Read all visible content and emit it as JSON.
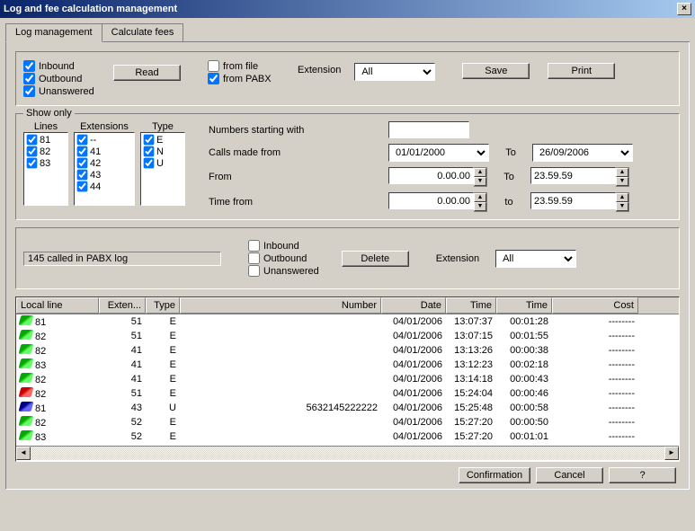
{
  "window": {
    "title": "Log and fee calculation management"
  },
  "tabs": [
    {
      "label": "Log management",
      "active": true
    },
    {
      "label": "Calculate fees",
      "active": false
    }
  ],
  "filters": {
    "inbound": "Inbound",
    "outbound": "Outbound",
    "unanswered": "Unanswered",
    "read_btn": "Read",
    "from_file": "from file",
    "from_pabx": "from PABX",
    "extension_label": "Extension",
    "extension_value": "All",
    "save_btn": "Save",
    "print_btn": "Print"
  },
  "showonly": {
    "legend": "Show only",
    "lines_label": "Lines",
    "extensions_label": "Extensions",
    "type_label": "Type",
    "lines": [
      "81",
      "82",
      "83"
    ],
    "extensions": [
      "--",
      "41",
      "42",
      "43",
      "44"
    ],
    "types": [
      "E",
      "N",
      "U"
    ],
    "numbers_starting_label": "Numbers starting with",
    "numbers_starting_value": "",
    "calls_from_label": "Calls made from",
    "calls_from_value": "01/01/2000",
    "calls_to_label": "To",
    "calls_to_value": "26/09/2006",
    "from_label": "From",
    "from_value": "0.00.00",
    "from_to_label": "To",
    "from_to_value": "23.59.59",
    "time_from_label": "Time from",
    "time_from_value": "0.00.00",
    "time_to_label": "to",
    "time_to_value": "23.59.59"
  },
  "mid": {
    "status": "145 called in PABX log",
    "inbound": "Inbound",
    "outbound": "Outbound",
    "unanswered": "Unanswered",
    "delete_btn": "Delete",
    "extension_label": "Extension",
    "extension_value": "All"
  },
  "grid_headers": [
    "Local line",
    "Exten...",
    "Type",
    "Number",
    "Date",
    "Time",
    "Time",
    "Cost"
  ],
  "grid_rows": [
    {
      "icon": "green",
      "line": "81",
      "ext": "51",
      "type": "E",
      "number": "",
      "date": "04/01/2006",
      "t1": "13:07:37",
      "t2": "00:01:28",
      "cost": "--------"
    },
    {
      "icon": "green",
      "line": "82",
      "ext": "51",
      "type": "E",
      "number": "",
      "date": "04/01/2006",
      "t1": "13:07:15",
      "t2": "00:01:55",
      "cost": "--------"
    },
    {
      "icon": "green",
      "line": "82",
      "ext": "41",
      "type": "E",
      "number": "",
      "date": "04/01/2006",
      "t1": "13:13:26",
      "t2": "00:00:38",
      "cost": "--------"
    },
    {
      "icon": "green",
      "line": "83",
      "ext": "41",
      "type": "E",
      "number": "",
      "date": "04/01/2006",
      "t1": "13:12:23",
      "t2": "00:02:18",
      "cost": "--------"
    },
    {
      "icon": "green",
      "line": "82",
      "ext": "41",
      "type": "E",
      "number": "",
      "date": "04/01/2006",
      "t1": "13:14:18",
      "t2": "00:00:43",
      "cost": "--------"
    },
    {
      "icon": "red",
      "line": "82",
      "ext": "51",
      "type": "E",
      "number": "",
      "date": "04/01/2006",
      "t1": "15:24:04",
      "t2": "00:00:46",
      "cost": "--------"
    },
    {
      "icon": "blue",
      "line": "81",
      "ext": "43",
      "type": "U",
      "number": "5632145222222",
      "date": "04/01/2006",
      "t1": "15:25:48",
      "t2": "00:00:58",
      "cost": "--------"
    },
    {
      "icon": "green",
      "line": "82",
      "ext": "52",
      "type": "E",
      "number": "",
      "date": "04/01/2006",
      "t1": "15:27:20",
      "t2": "00:00:50",
      "cost": "--------"
    },
    {
      "icon": "green",
      "line": "83",
      "ext": "52",
      "type": "E",
      "number": "",
      "date": "04/01/2006",
      "t1": "15:27:20",
      "t2": "00:01:01",
      "cost": "--------"
    }
  ],
  "footer": {
    "confirm": "Confirmation",
    "cancel": "Cancel",
    "help": "?"
  }
}
